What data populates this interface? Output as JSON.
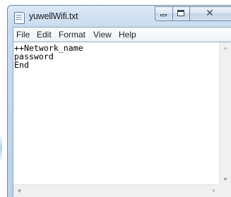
{
  "window": {
    "title": "yuwellWifi.txt",
    "close_glyph": "✕"
  },
  "menu": {
    "file": "File",
    "edit": "Edit",
    "format": "Format",
    "view": "View",
    "help": "Help"
  },
  "editor": {
    "content": "++Network_name\npassword\nEnd"
  },
  "icons": {
    "app": "notepad-icon",
    "minimize": "minimize-icon",
    "maximize": "maximize-icon",
    "close": "close-icon"
  },
  "colors": {
    "titlebar": "#c9dcf0",
    "border": "#6d8aa8",
    "editor_bg": "#ffffff"
  }
}
